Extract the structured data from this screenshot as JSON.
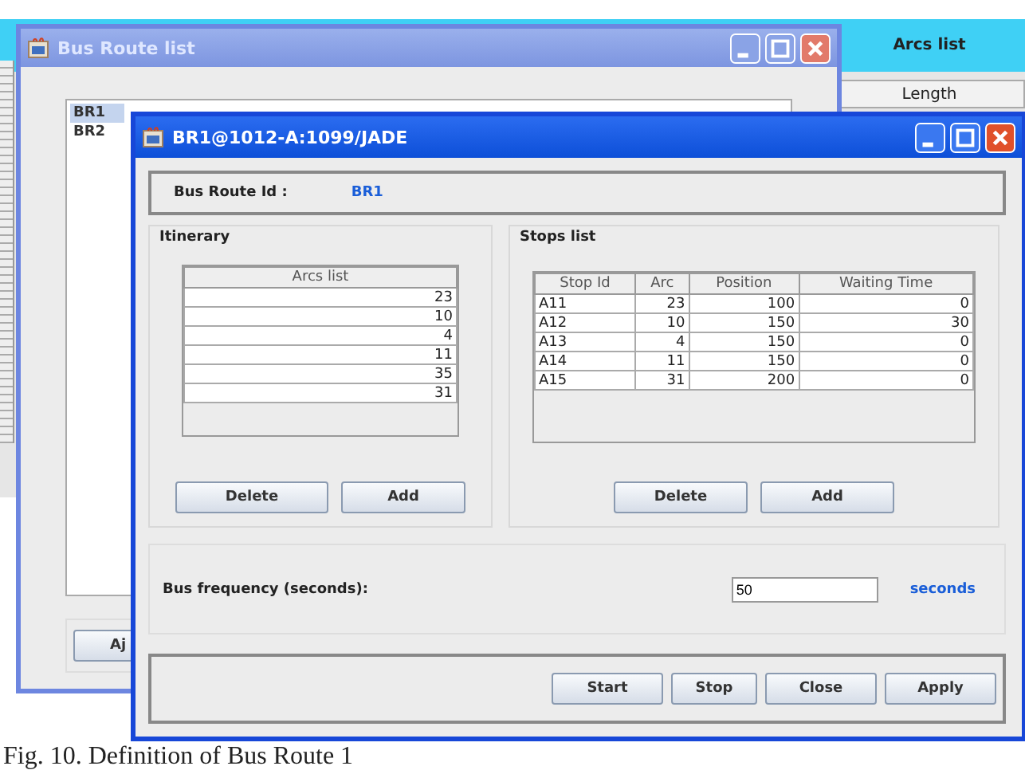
{
  "background_window": {
    "header": "Arcs list",
    "column": "Length"
  },
  "list_window": {
    "title": "Bus Route list",
    "routes": [
      {
        "label": "BR1",
        "selected": true
      },
      {
        "label": "BR2",
        "selected": false
      }
    ],
    "button": "Aj"
  },
  "route_window": {
    "title": "BR1@1012-A:1099/JADE",
    "route_id_label": "Bus Route Id :",
    "route_id": "BR1",
    "itinerary": {
      "title": "Itinerary",
      "column": "Arcs list",
      "rows": [
        "23",
        "10",
        "4",
        "11",
        "35",
        "31"
      ],
      "buttons": [
        "Delete",
        "Add"
      ]
    },
    "stops": {
      "title": "Stops list",
      "columns": [
        "Stop Id",
        "Arc",
        "Position",
        "Waiting Time"
      ],
      "rows": [
        [
          "A11",
          "23",
          "100",
          "0"
        ],
        [
          "A12",
          "10",
          "150",
          "30"
        ],
        [
          "A13",
          "4",
          "150",
          "0"
        ],
        [
          "A14",
          "11",
          "150",
          "0"
        ],
        [
          "A15",
          "31",
          "200",
          "0"
        ]
      ],
      "buttons": [
        "Delete",
        "Add"
      ]
    },
    "frequency": {
      "label": "Bus frequency (seconds):",
      "value": "50",
      "unit": "seconds"
    },
    "buttons": [
      "Start",
      "Stop",
      "Close",
      "Apply"
    ]
  },
  "caption": "Fig. 10. Definition of Bus Route 1"
}
